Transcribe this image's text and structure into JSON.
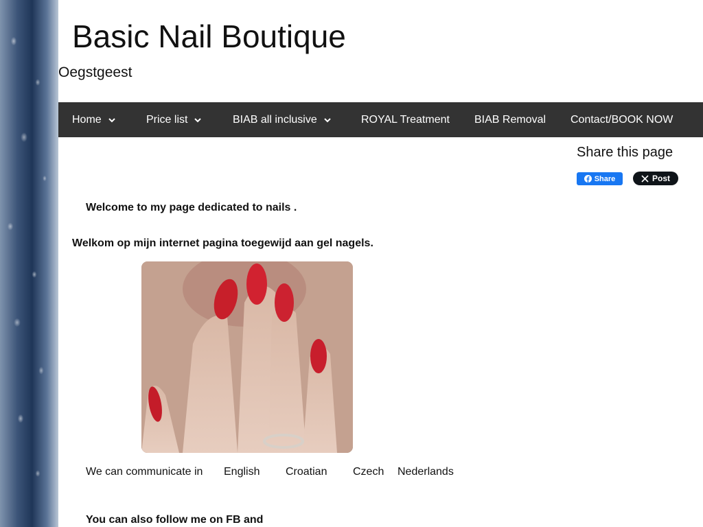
{
  "header": {
    "title": "Basic Nail Boutique",
    "subtitle": "Oegstgeest"
  },
  "nav": {
    "items": [
      {
        "label": "Home",
        "has_dropdown": true
      },
      {
        "label": "Price list",
        "has_dropdown": true
      },
      {
        "label": "BIAB all inclusive",
        "has_dropdown": true
      },
      {
        "label": "ROYAL Treatment",
        "has_dropdown": false
      },
      {
        "label": "BIAB Removal",
        "has_dropdown": false
      },
      {
        "label": "Contact/BOOK NOW",
        "has_dropdown": false
      }
    ],
    "background": "#333333"
  },
  "share": {
    "title": "Share this page",
    "facebook_label": "Share",
    "x_label": "Post",
    "facebook_color": "#1877f2",
    "x_color": "#0f1419"
  },
  "content": {
    "welcome_en": "Welcome to my page dedicated to nails .",
    "welcome_nl": "Welkom op mijn internet pagina toegewijd aan gel nagels.",
    "photo_icon": "nails-photo",
    "communicate_label": "We can communicate in",
    "languages": [
      "English",
      "Croatian",
      "Czech",
      "Nederlands"
    ],
    "follow_text": "You can also follow me on FB and"
  }
}
